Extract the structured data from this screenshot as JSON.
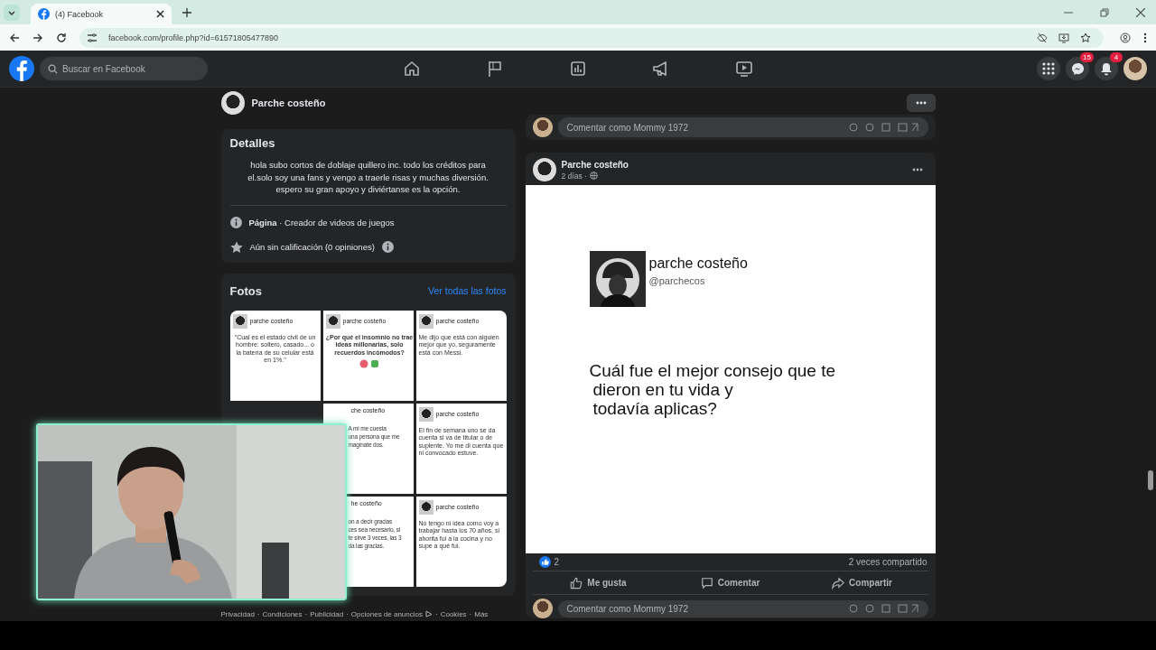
{
  "browser": {
    "tab_title": "(4) Facebook",
    "url": "facebook.com/profile.php?id=61571805477890"
  },
  "navbar": {
    "search_placeholder": "Buscar en Facebook",
    "nav_icons": [
      {
        "kind": "home"
      },
      {
        "kind": "flag"
      },
      {
        "kind": "chart"
      },
      {
        "kind": "megaphone"
      },
      {
        "kind": "video"
      }
    ],
    "messenger_badge": "15",
    "notifications_badge": "4"
  },
  "page_header": {
    "name": "Parche costeño"
  },
  "details": {
    "title": "Detalles",
    "bio": "hola subo cortos de doblaje quillero inc. todo los créditos para el.solo soy una fans y vengo a traerle risas y muchas diversión. espero su gran apoyo y diviértanse es la opción.",
    "category": "**Página** · Creador de videos de juegos",
    "rating": "Aún sin calificación (0 opiniones)"
  },
  "photos": {
    "title": "Fotos",
    "link": "Ver todas las fotos",
    "tiles": [
      {
        "kind": "tweet",
        "author": "parche costeño",
        "text": "\"Cual es el estado civil de un hombre: soltero, casado... o la batería de su celular está en 1%.\"",
        "centered": true,
        "bold": false
      },
      {
        "kind": "tweet",
        "author": "parche costeño",
        "text": "¿Por qué el insomnio no trae ideas millonarias, solo recuerdos incómodos?",
        "centered": true,
        "bold": true
      },
      {
        "kind": "tweet",
        "author": "parche costeño",
        "text": "Me dijo que está con alguien mejor que yo, seguramente está con Messi.",
        "centered": false,
        "bold": false
      },
      {
        "kind": "hidden"
      },
      {
        "kind": "partial",
        "author": "che costeño",
        "lines": [
          "A mi me cuesta",
          "una persona que me",
          "magínate dos."
        ]
      },
      {
        "kind": "tweet",
        "author": "parche costeño",
        "text": "El fin de semana uno se da cuenta si va de titular o de suplente. Yo me di cuenta que ni convocado estuve.",
        "centered": false,
        "bold": false
      },
      {
        "kind": "hidden"
      },
      {
        "kind": "partial",
        "author": "he costeño",
        "lines": [
          "on a decir gracias",
          "ces sea necesario, si",
          "te sirve 3 veces, las 3",
          "da las gracias."
        ]
      },
      {
        "kind": "tweet",
        "author": "parche costeño",
        "text": "No tengo ni idea como voy a trabajar hasta los 70 años, si ahorita fui a la cocina y no supe a qué fui.",
        "centered": false,
        "bold": false
      }
    ]
  },
  "footer": {
    "separator": "·",
    "links": [
      "Privacidad",
      "Condiciones",
      "Publicidad",
      "Opciones de anuncios",
      "Cookies",
      "Más"
    ]
  },
  "previous_post": {
    "comment_placeholder": "Comentar como Mommy 1972"
  },
  "post": {
    "author": "Parche costeño",
    "time": "2 días ·",
    "image": {
      "name": "parche costeño",
      "handle": "@parchecos",
      "question_lines": [
        "Cuál fue el mejor consejo que te",
        "dieron en tu vida y",
        "todavía aplicas?"
      ]
    },
    "reactions": "2",
    "shares": "2 veces compartido",
    "actions": [
      {
        "kind": "like",
        "label": "Me gusta"
      },
      {
        "kind": "comment",
        "label": "Comentar"
      },
      {
        "kind": "share",
        "label": "Compartir"
      }
    ],
    "comment_placeholder": "Comentar como Mommy 1972"
  }
}
